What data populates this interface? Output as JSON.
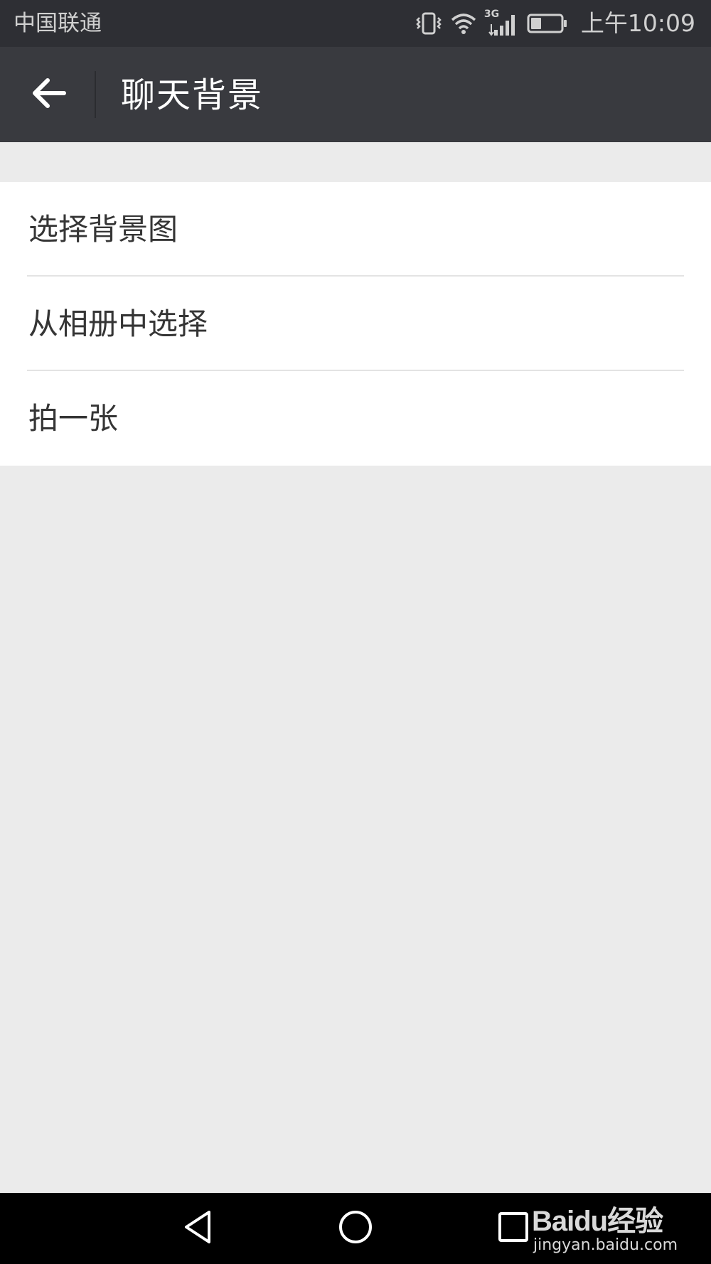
{
  "status_bar": {
    "carrier": "中国联通",
    "network_type": "3G",
    "time": "上午10:09",
    "battery_level": 0.35
  },
  "header": {
    "title": "聊天背景",
    "back_icon": "arrow-left-icon"
  },
  "menu": {
    "items": [
      {
        "label": "选择背景图"
      },
      {
        "label": "从相册中选择"
      },
      {
        "label": "拍一张"
      }
    ]
  },
  "nav_bar": {
    "icons": [
      "back-triangle-icon",
      "home-circle-icon",
      "recents-square-icon"
    ]
  },
  "watermark": {
    "logo": "Baidu经验",
    "url": "jingyan.baidu.com"
  },
  "colors": {
    "status_bar_bg": "#2e2f34",
    "title_bar_bg": "#393a3f",
    "page_bg": "#ebebeb",
    "list_bg": "#ffffff",
    "nav_bar_bg": "#000000"
  }
}
